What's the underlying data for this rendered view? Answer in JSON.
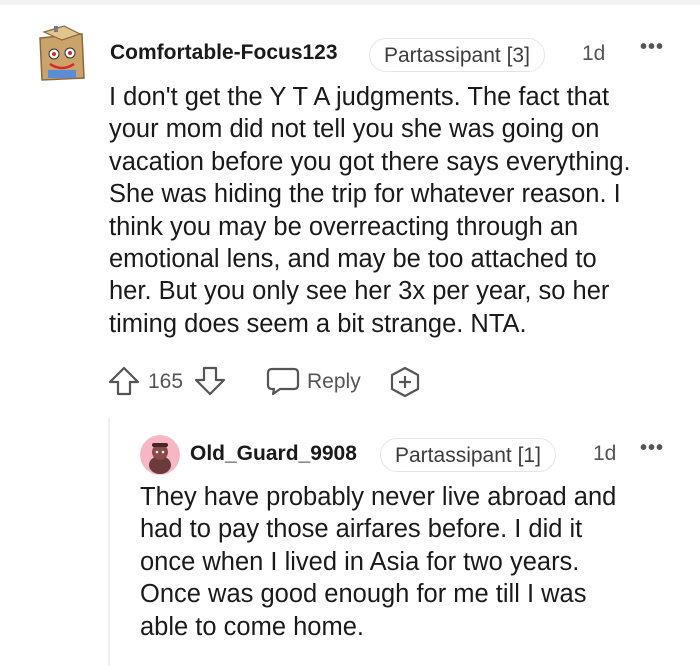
{
  "comments": [
    {
      "username": "Comfortable-Focus123",
      "flair": "Partassipant [3]",
      "time": "1d",
      "more": "•••",
      "body_lines": [
        "I don't get the Y T A judgments. The fact that",
        "your mom did not tell you she was going on",
        "vacation before you got there says everything.",
        "She was hiding the trip for whatever reason. I",
        "think you may be overreacting through an",
        "emotional lens, and may be too attached to",
        "her. But you only see her 3x per year, so her",
        "timing does seem a bit strange. NTA."
      ],
      "score": "165",
      "reply_label": "Reply"
    },
    {
      "username": "Old_Guard_9908",
      "flair": "Partassipant [1]",
      "time": "1d",
      "more": "•••",
      "body_lines": [
        "They have probably never live abroad and",
        "had to pay those airfares before. I did it",
        "once when I lived in Asia for two years.",
        "Once was good enough for me till I was",
        "able to come home."
      ]
    }
  ],
  "icons": {
    "upvote": "arrow-up-icon",
    "downvote": "arrow-down-icon",
    "reply": "speech-bubble-icon",
    "award": "plus-circle-icon"
  },
  "colors": {
    "text": "#1a1a1b",
    "muted": "#555555",
    "flair_border": "#e3e5e8",
    "avatar2_bg": "#f6b6c4"
  }
}
